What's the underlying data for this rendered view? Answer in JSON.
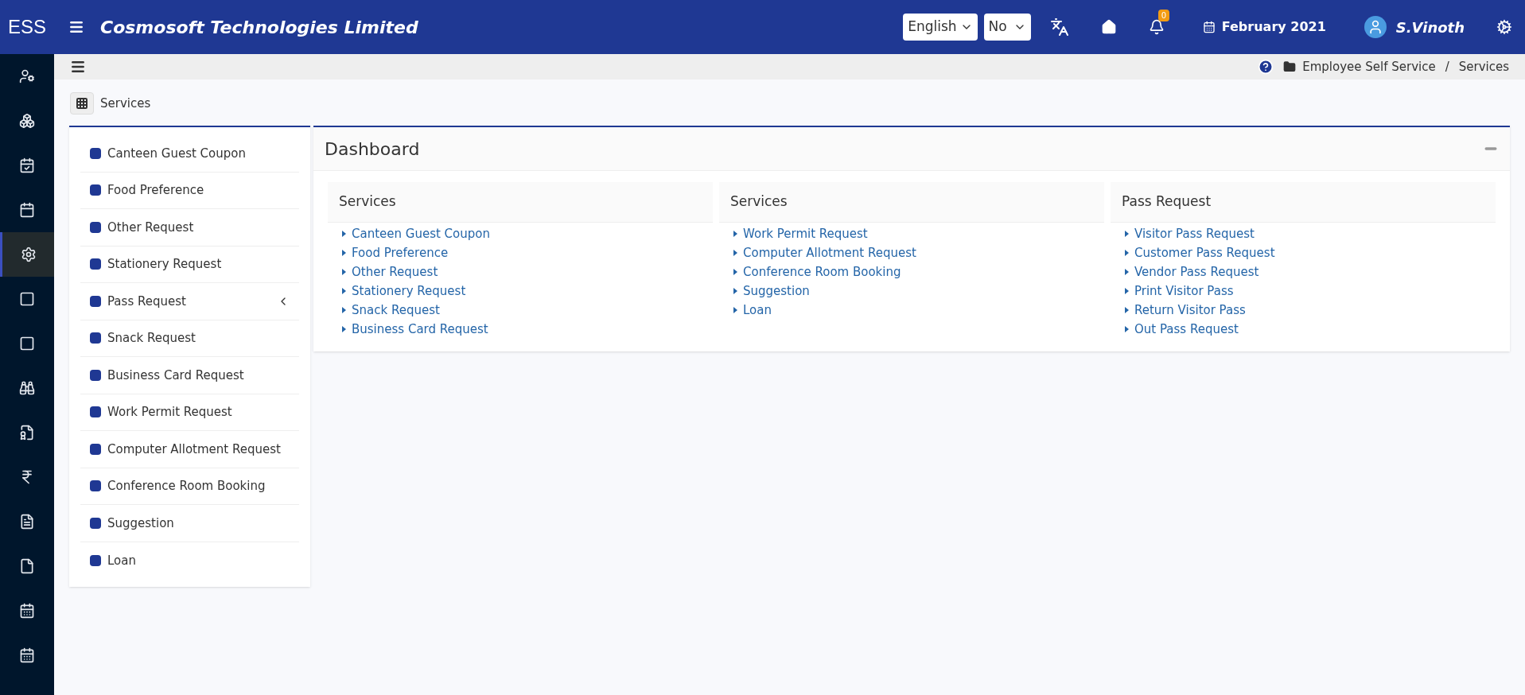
{
  "header": {
    "app_name": "ESS",
    "company": "Cosmosoft Technologies Limited",
    "language": "English",
    "option": "No",
    "notifications": "0",
    "period": "February 2021",
    "user": "S.Vinoth"
  },
  "sidebar": [
    {
      "kind": "users",
      "selected": false
    },
    {
      "kind": "boxes",
      "selected": false
    },
    {
      "kind": "calendar-check",
      "selected": false
    },
    {
      "kind": "calendar",
      "selected": false
    },
    {
      "kind": "gears",
      "selected": true
    },
    {
      "kind": "square",
      "selected": false
    },
    {
      "kind": "square",
      "selected": false
    },
    {
      "kind": "binoculars",
      "selected": false
    },
    {
      "kind": "file-badge",
      "selected": false
    },
    {
      "kind": "currency",
      "selected": false
    },
    {
      "kind": "document",
      "selected": false
    },
    {
      "kind": "file",
      "selected": false
    },
    {
      "kind": "calendar-grid",
      "selected": false
    },
    {
      "kind": "calendar-grid",
      "selected": false
    }
  ],
  "breadcrumb": [
    "Employee Self Service",
    "Services"
  ],
  "breadcrumb_separator": "/",
  "page_title": "Services",
  "menu": [
    {
      "label": "Canteen Guest Coupon",
      "expandable": false
    },
    {
      "label": "Food Preference",
      "expandable": false
    },
    {
      "label": "Other Request",
      "expandable": false
    },
    {
      "label": "Stationery Request",
      "expandable": false
    },
    {
      "label": "Pass Request",
      "expandable": true
    },
    {
      "label": "Snack Request",
      "expandable": false
    },
    {
      "label": "Business Card Request",
      "expandable": false
    },
    {
      "label": "Work Permit Request",
      "expandable": false
    },
    {
      "label": "Computer Allotment Request",
      "expandable": false
    },
    {
      "label": "Conference Room Booking",
      "expandable": false
    },
    {
      "label": "Suggestion",
      "expandable": false
    },
    {
      "label": "Loan",
      "expandable": false
    }
  ],
  "dashboard": {
    "title": "Dashboard",
    "groups": [
      {
        "title": "Services",
        "links": [
          "Canteen Guest Coupon",
          "Food Preference",
          "Other Request",
          "Stationery Request",
          "Snack Request",
          "Business Card Request"
        ]
      },
      {
        "title": "Services",
        "links": [
          "Work Permit Request",
          "Computer Allotment Request",
          "Conference Room Booking",
          "Suggestion",
          "Loan"
        ]
      },
      {
        "title": "Pass Request",
        "links": [
          "Visitor Pass Request",
          "Customer Pass Request",
          "Vendor Pass Request",
          "Print Visitor Pass",
          "Return Visitor Pass",
          "Out Pass Request"
        ]
      }
    ]
  }
}
